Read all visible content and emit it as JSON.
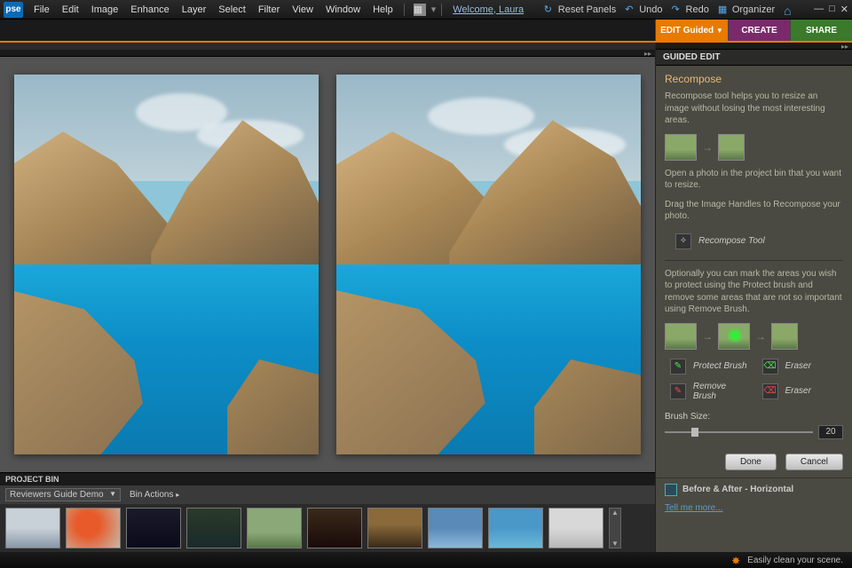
{
  "logo": "pse",
  "menu": [
    "File",
    "Edit",
    "Image",
    "Enhance",
    "Layer",
    "Select",
    "Filter",
    "View",
    "Window",
    "Help"
  ],
  "welcome": "Welcome, Laura",
  "topright": {
    "reset": "Reset Panels",
    "undo": "Undo",
    "redo": "Redo",
    "organizer": "Organizer"
  },
  "tabs": {
    "edit": "EDIT Guided",
    "create": "CREATE",
    "share": "SHARE"
  },
  "panel": {
    "header": "GUIDED EDIT",
    "title": "Recompose",
    "desc": "Recompose tool helps you to resize an image without losing the most interesting areas.",
    "open": "Open a photo in the project bin that you want to resize.",
    "drag": "Drag the Image Handles to Recompose your photo.",
    "tool": "Recompose Tool",
    "optional": "Optionally you can mark the areas you wish to protect using the Protect brush and remove some areas that are not so important using Remove Brush.",
    "protect": "Protect Brush",
    "protectEraser": "Eraser",
    "remove": "Remove Brush",
    "removeEraser": "Eraser",
    "brushSize": "Brush Size:",
    "sizeVal": "20",
    "done": "Done",
    "cancel": "Cancel",
    "viewMode": "Before & After - Horizontal",
    "tellMore": "Tell me more..."
  },
  "bin": {
    "header": "PROJECT BIN",
    "select": "Reviewers Guide Demo",
    "actions": "Bin Actions"
  },
  "status": "Easily clean your scene."
}
